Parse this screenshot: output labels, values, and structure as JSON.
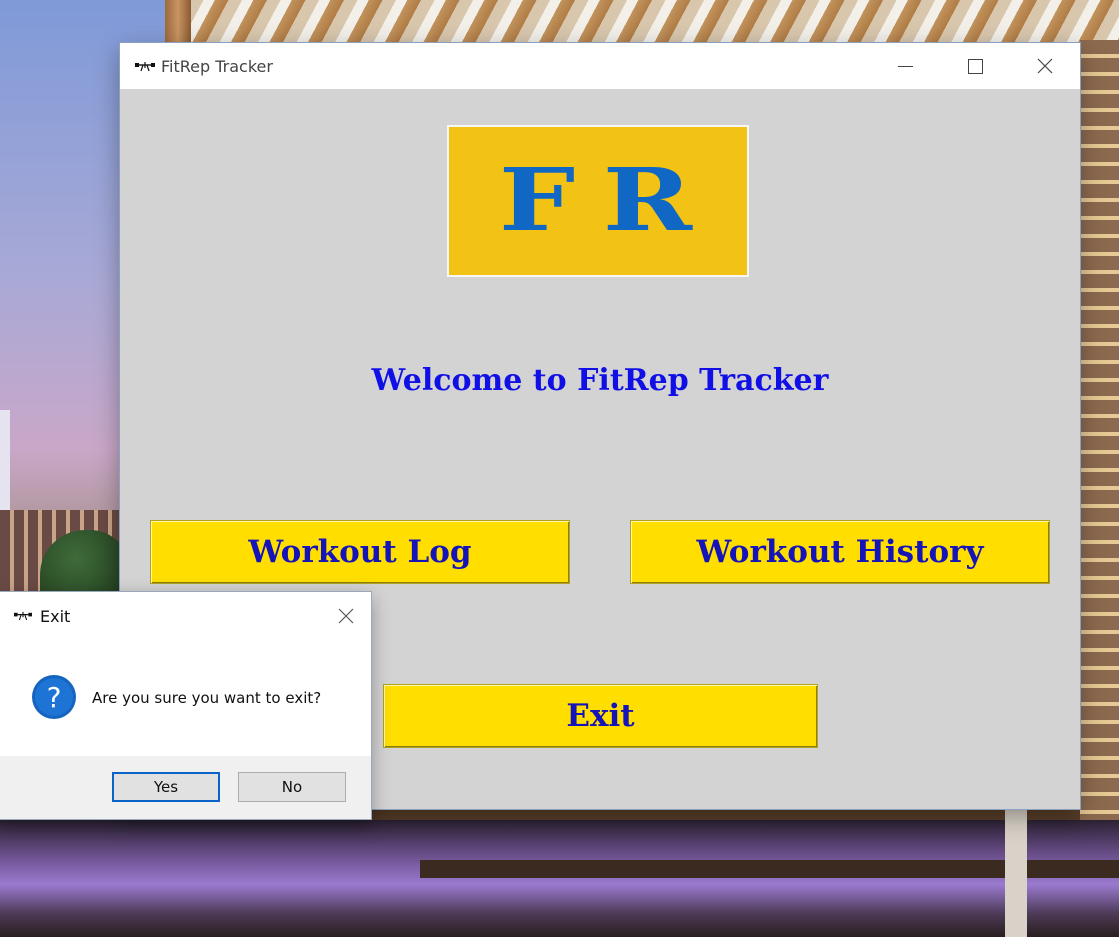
{
  "main_window": {
    "title": "FitRep Tracker",
    "logo_text": "FR",
    "welcome": "Welcome to FitRep Tracker",
    "buttons": {
      "workout_log": "Workout Log",
      "workout_history": "Workout History",
      "exit": "Exit"
    },
    "icons": [
      "app-icon",
      "minimize-icon",
      "maximize-icon",
      "close-icon"
    ]
  },
  "exit_dialog": {
    "title": "Exit",
    "message": "Are you sure you want to exit?",
    "yes_label": "Yes",
    "no_label": "No",
    "icons": [
      "app-icon",
      "question-icon",
      "close-icon"
    ]
  },
  "colors": {
    "window_bg": "#d3d3d3",
    "logo_bg": "#f2c314",
    "logo_text": "#1168c4",
    "welcome_text": "#1010e6",
    "button_bg": "#ffde00",
    "button_text": "#1414b8",
    "dialog_default_border": "#0a64c8"
  }
}
